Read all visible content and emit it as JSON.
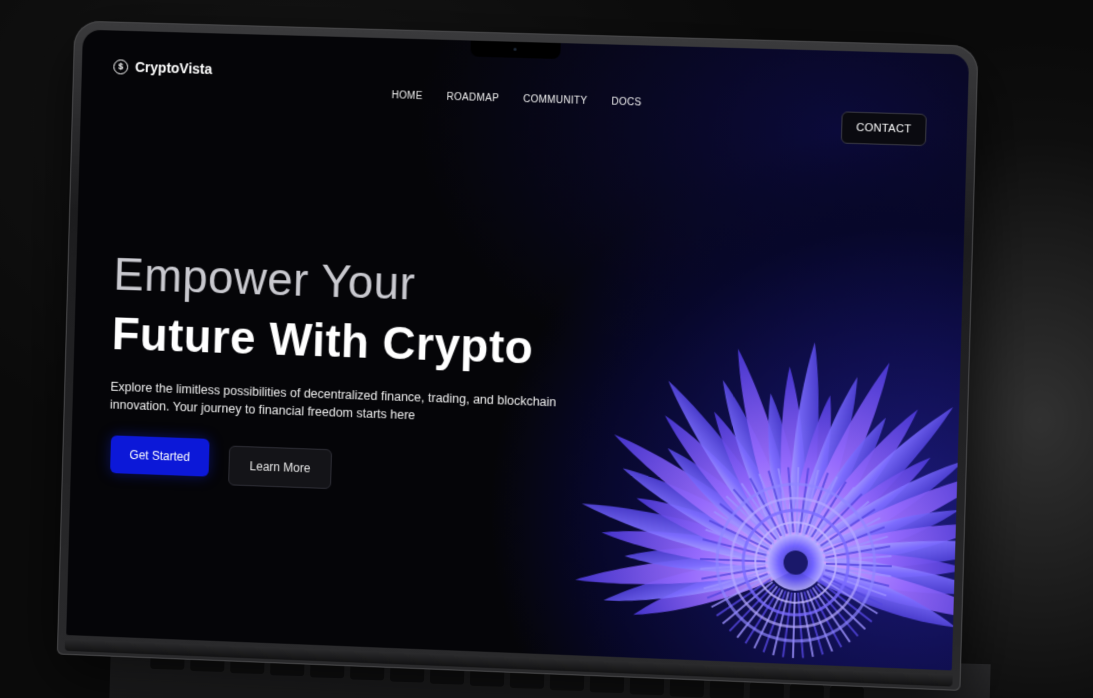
{
  "brand": {
    "name": "CryptoVista",
    "icon_glyph": "$",
    "icon_name": "dollar-coin-icon"
  },
  "nav": {
    "items": [
      {
        "label": "HOME"
      },
      {
        "label": "ROADMAP"
      },
      {
        "label": "COMMUNITY"
      },
      {
        "label": "DOCS"
      }
    ],
    "contact_label": "CONTACT"
  },
  "hero": {
    "line1": "Empower Your",
    "line2": "Future With Crypto",
    "description": "Explore the limitless possibilities of decentralized finance, trading, and blockchain innovation. Your journey to financial freedom starts here",
    "primary_cta": "Get Started",
    "secondary_cta": "Learn More"
  },
  "colors": {
    "accent": "#0c18d8",
    "background": "#050508",
    "flower_primary": "#7b6cff",
    "flower_secondary": "#b58cff"
  }
}
